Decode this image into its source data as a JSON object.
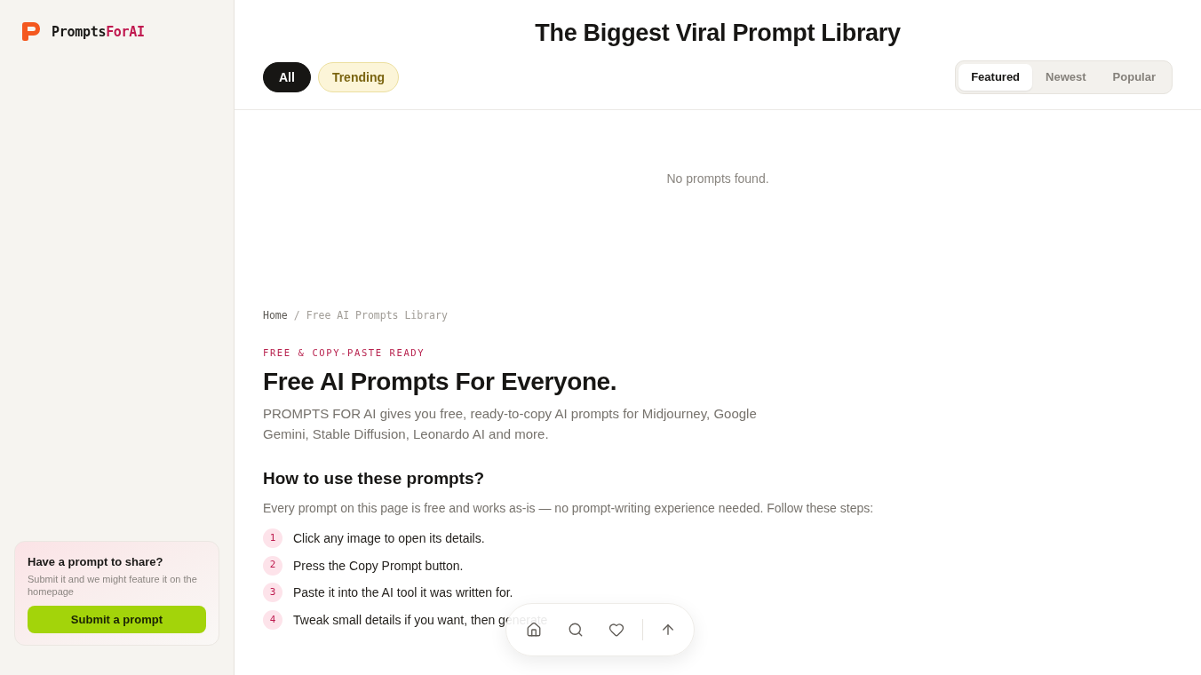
{
  "sidebar": {
    "logo": {
      "name": "Prompts",
      "accent": "ForAI"
    },
    "promo_card": {
      "title": "Have a prompt to share?",
      "description": "Submit it and we might feature it on the homepage",
      "button": "Submit a prompt"
    }
  },
  "header": {
    "title": "The Biggest Viral Prompt Library",
    "filters": [
      {
        "label": "All",
        "selected": true
      },
      {
        "label": "Trending",
        "selected": false
      }
    ],
    "sort_tabs": [
      {
        "label": "Featured",
        "selected": true
      },
      {
        "label": "Newest",
        "selected": false
      },
      {
        "label": "Popular",
        "selected": false
      }
    ]
  },
  "empty_state": "No prompts found.",
  "breadcrumb": {
    "separator": "/",
    "items": [
      {
        "label": "Home",
        "current": false
      },
      {
        "label": "Free AI Prompts Library",
        "current": true
      }
    ]
  },
  "intro": {
    "eyebrow": "FREE & COPY-PASTE READY",
    "title": "Free AI Prompts For Everyone.",
    "description": "PROMPTS FOR AI gives you free, ready-to-copy AI prompts for Midjourney, Google Gemini, Stable Diffusion, Leonardo AI and more."
  },
  "how_to": {
    "title": "How to use these prompts?",
    "description": "Every prompt on this page is free and works as-is — no prompt-writing experience needed. Follow these steps:",
    "steps": [
      {
        "number": "1",
        "text": "Click any image to open its details."
      },
      {
        "number": "2",
        "text": "Press the Copy Prompt button."
      },
      {
        "number": "3",
        "text": "Paste it into the AI tool it was written for."
      },
      {
        "number": "4",
        "text": "Tweak small details if you want, then generate"
      }
    ]
  }
}
